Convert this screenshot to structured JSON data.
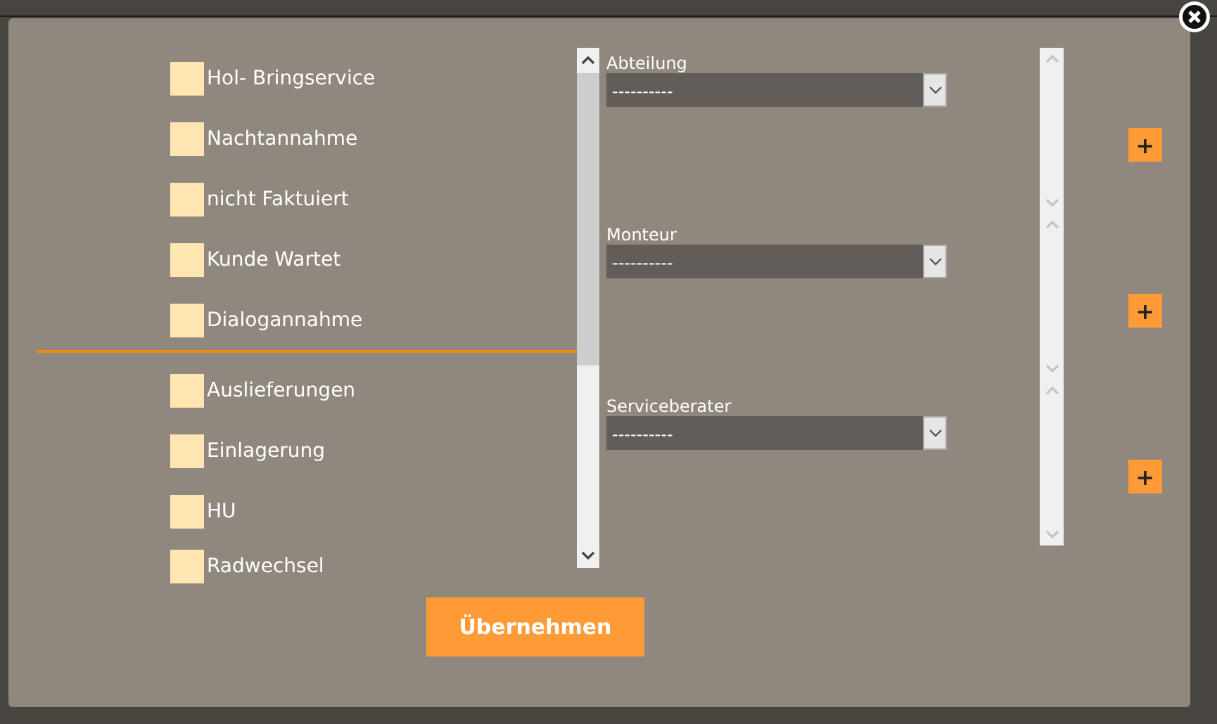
{
  "groups": [
    {
      "options": [
        {
          "label": "Hol- Bringservice",
          "checked": false
        },
        {
          "label": "Nachtannahme",
          "checked": false
        },
        {
          "label": "nicht Faktuiert",
          "checked": false
        },
        {
          "label": "Kunde Wartet",
          "checked": false
        },
        {
          "label": "Dialogannahme",
          "checked": false
        }
      ]
    },
    {
      "options": [
        {
          "label": "Auslieferungen",
          "checked": false
        },
        {
          "label": "Einlagerung",
          "checked": false
        },
        {
          "label": "HU",
          "checked": false
        },
        {
          "label": "Radwechsel",
          "checked": false
        }
      ]
    }
  ],
  "selects": [
    {
      "label": "Abteilung",
      "value": "----------",
      "add": "+"
    },
    {
      "label": "Monteur",
      "value": "----------",
      "add": "+"
    },
    {
      "label": "Serviceberater",
      "value": "----------",
      "add": "+"
    }
  ],
  "apply_button": "Übernehmen"
}
